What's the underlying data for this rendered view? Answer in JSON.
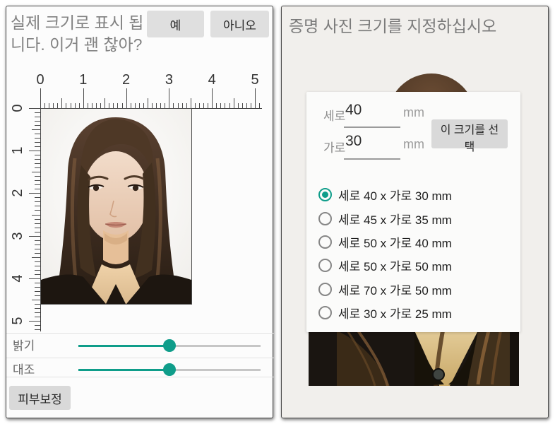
{
  "accent_color": "#0f9d8a",
  "left_panel": {
    "title": "실제 크기로 표시 됩니다. 이거 괜 찮아?",
    "yes_button": "예",
    "no_button": "아니오",
    "ruler_numbers": [
      "0",
      "1",
      "2",
      "3",
      "4",
      "5"
    ],
    "brightness": {
      "label": "밝기",
      "value_pct": 50
    },
    "contrast": {
      "label": "대조",
      "value_pct": 50
    },
    "skin_button": "피부보정"
  },
  "right_panel": {
    "title": "증명 사진 크기를 지정하십시오",
    "dialog": {
      "height_label": "세로",
      "height_value": "40",
      "height_unit": "mm",
      "width_label": "가로",
      "width_value": "30",
      "width_unit": "mm",
      "select_button": "이 크기를 선택",
      "options": [
        {
          "label": "세로 40 x 가로 30 mm",
          "selected": true
        },
        {
          "label": "세로 45 x 가로 35 mm",
          "selected": false
        },
        {
          "label": "세로 50 x 가로 40 mm",
          "selected": false
        },
        {
          "label": "세로 50 x 가로 50 mm",
          "selected": false
        },
        {
          "label": "세로 70 x 가로 50 mm",
          "selected": false
        },
        {
          "label": "세로 30 x 가로 25 mm",
          "selected": false
        }
      ]
    }
  }
}
